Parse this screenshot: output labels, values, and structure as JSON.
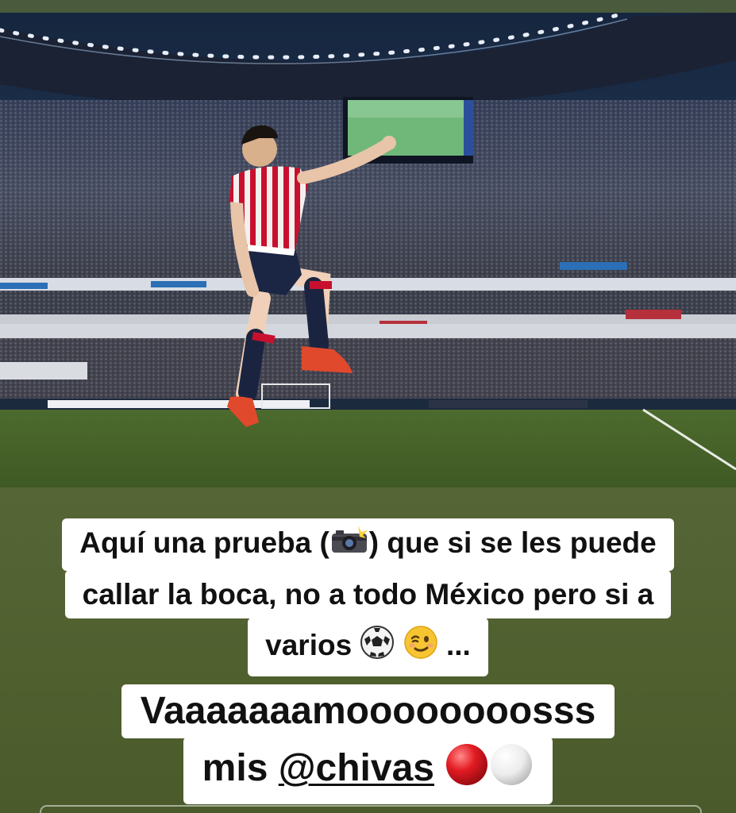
{
  "story": {
    "photo_alt": "",
    "caption_1": {
      "line1_a": "Aquí una prueba (",
      "line1_b": ") que si se les puede",
      "line2": "callar la boca, no a todo México pero si a",
      "line3_a": "varios",
      "line3_b": "..."
    },
    "caption_2": {
      "line1": "Vaaaaaaamoooooooosss",
      "line2_a": "mis ",
      "mention": "@chivas"
    },
    "icons": [
      "camera-flash-icon",
      "soccer-ball-icon",
      "winking-face-icon",
      "red-circle-icon",
      "white-circle-icon"
    ],
    "colors": {
      "caption_bg": "#ffffff",
      "caption_text": "#111111",
      "background": "#55632f",
      "jersey_red": "#c8102e"
    }
  }
}
